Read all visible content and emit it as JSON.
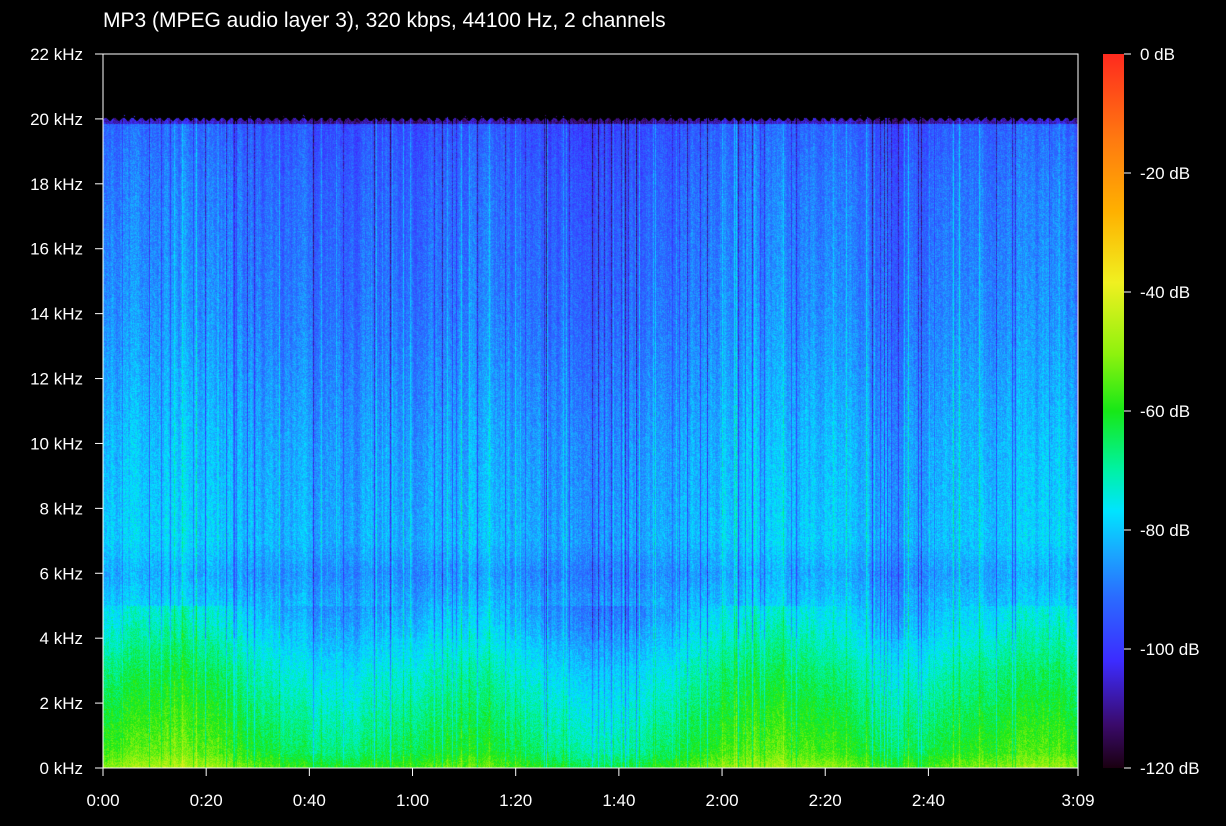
{
  "title": "MP3 (MPEG audio layer 3), 320 kbps, 44100 Hz, 2 channels",
  "chart_data": {
    "type": "heatmap",
    "title": "MP3 (MPEG audio layer 3), 320 kbps, 44100 Hz, 2 channels",
    "xlabel": "",
    "ylabel": "",
    "x_ticks": [
      "0:00",
      "0:20",
      "0:40",
      "1:00",
      "1:20",
      "1:40",
      "2:00",
      "2:20",
      "2:40",
      "3:09"
    ],
    "x_tick_seconds": [
      0,
      20,
      40,
      60,
      80,
      100,
      120,
      140,
      160,
      189
    ],
    "xlim_seconds": [
      0,
      189
    ],
    "y_ticks": [
      "0 kHz",
      "2 kHz",
      "4 kHz",
      "6 kHz",
      "8 kHz",
      "10 kHz",
      "12 kHz",
      "14 kHz",
      "16 kHz",
      "18 kHz",
      "20 kHz",
      "22 kHz"
    ],
    "y_tick_khz": [
      0,
      2,
      4,
      6,
      8,
      10,
      12,
      14,
      16,
      18,
      20,
      22
    ],
    "ylim_khz": [
      0,
      22
    ],
    "frequency_cutoff_khz": 20,
    "colorbar": {
      "ticks": [
        "0 dB",
        "-20 dB",
        "-40 dB",
        "-60 dB",
        "-80 dB",
        "-100 dB",
        "-120 dB"
      ],
      "tick_db": [
        0,
        -20,
        -40,
        -60,
        -80,
        -100,
        -120
      ],
      "range_db": [
        -120,
        0
      ],
      "colors": [
        "#1a0010",
        "#3a0a6a",
        "#3c2cff",
        "#2a6cff",
        "#1aa6ff",
        "#00e4ff",
        "#00f2a0",
        "#17e817",
        "#8ef20e",
        "#f0f020",
        "#ffb000",
        "#ff7a10",
        "#ff2a1e"
      ],
      "color_stops": [
        0,
        0.06,
        0.15,
        0.24,
        0.3,
        0.36,
        0.42,
        0.5,
        0.58,
        0.68,
        0.78,
        0.88,
        1
      ]
    },
    "energy_profile": {
      "description_free": true,
      "bands_khz": [
        0,
        0.5,
        1.5,
        3,
        4.5,
        6,
        7,
        10,
        14,
        18,
        20
      ],
      "level_db": [
        -55,
        -62,
        -66,
        -72,
        -80,
        -86,
        -82,
        -84,
        -89,
        -92,
        -95
      ]
    },
    "legend": "colorbar-right",
    "grid": false
  }
}
